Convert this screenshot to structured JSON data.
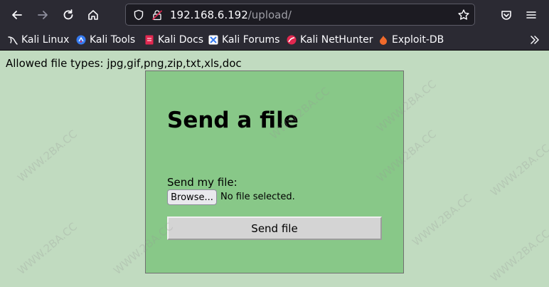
{
  "browser": {
    "url_host": "192.168.6.192",
    "url_path": "/upload/",
    "bookmarks": [
      {
        "label": "Kali Linux",
        "icon": "kali-dragon-icon"
      },
      {
        "label": "Kali Tools",
        "icon": "kali-tools-icon"
      },
      {
        "label": "Kali Docs",
        "icon": "kali-docs-icon"
      },
      {
        "label": "Kali Forums",
        "icon": "kali-forums-icon"
      },
      {
        "label": "Kali NetHunter",
        "icon": "kali-nethunter-icon"
      },
      {
        "label": "Exploit-DB",
        "icon": "exploit-db-icon"
      }
    ],
    "colors": {
      "chrome": "#2b2a33",
      "urlbar": "#1c1b22"
    }
  },
  "page": {
    "allowed_types": "Allowed file types: jpg,gif,png,zip,txt,xls,doc",
    "title": "Send a file",
    "file_label": "Send my file:",
    "browse_label": "Browse...",
    "no_file_text": "No file selected.",
    "submit_label": "Send file",
    "colors": {
      "background": "#c1dbc0",
      "panel": "#88c888"
    }
  },
  "watermark": "WWW.2BA.CC"
}
